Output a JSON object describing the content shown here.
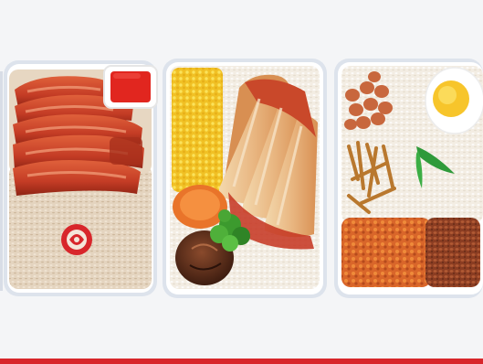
{
  "scene": {
    "image_alt": "",
    "colors": {
      "background": "#f4f5f7",
      "tray_edge": "#dfe4ec",
      "rice": "#f2ece2",
      "brown_rice": "#e3d3bd",
      "char_siu": "#c9482a",
      "sauce": "#d8262b",
      "corn": "#f3c82a",
      "chicken": "#e9c28f",
      "peanut": "#c8673d",
      "egg_yolk": "#f7c52b",
      "sambal": "#e06a2a",
      "bottom_bar": "#d8262b"
    },
    "items": [
      "char-siu-rice-tray",
      "chicken-rice-tray",
      "nasi-lemak-tray"
    ]
  }
}
